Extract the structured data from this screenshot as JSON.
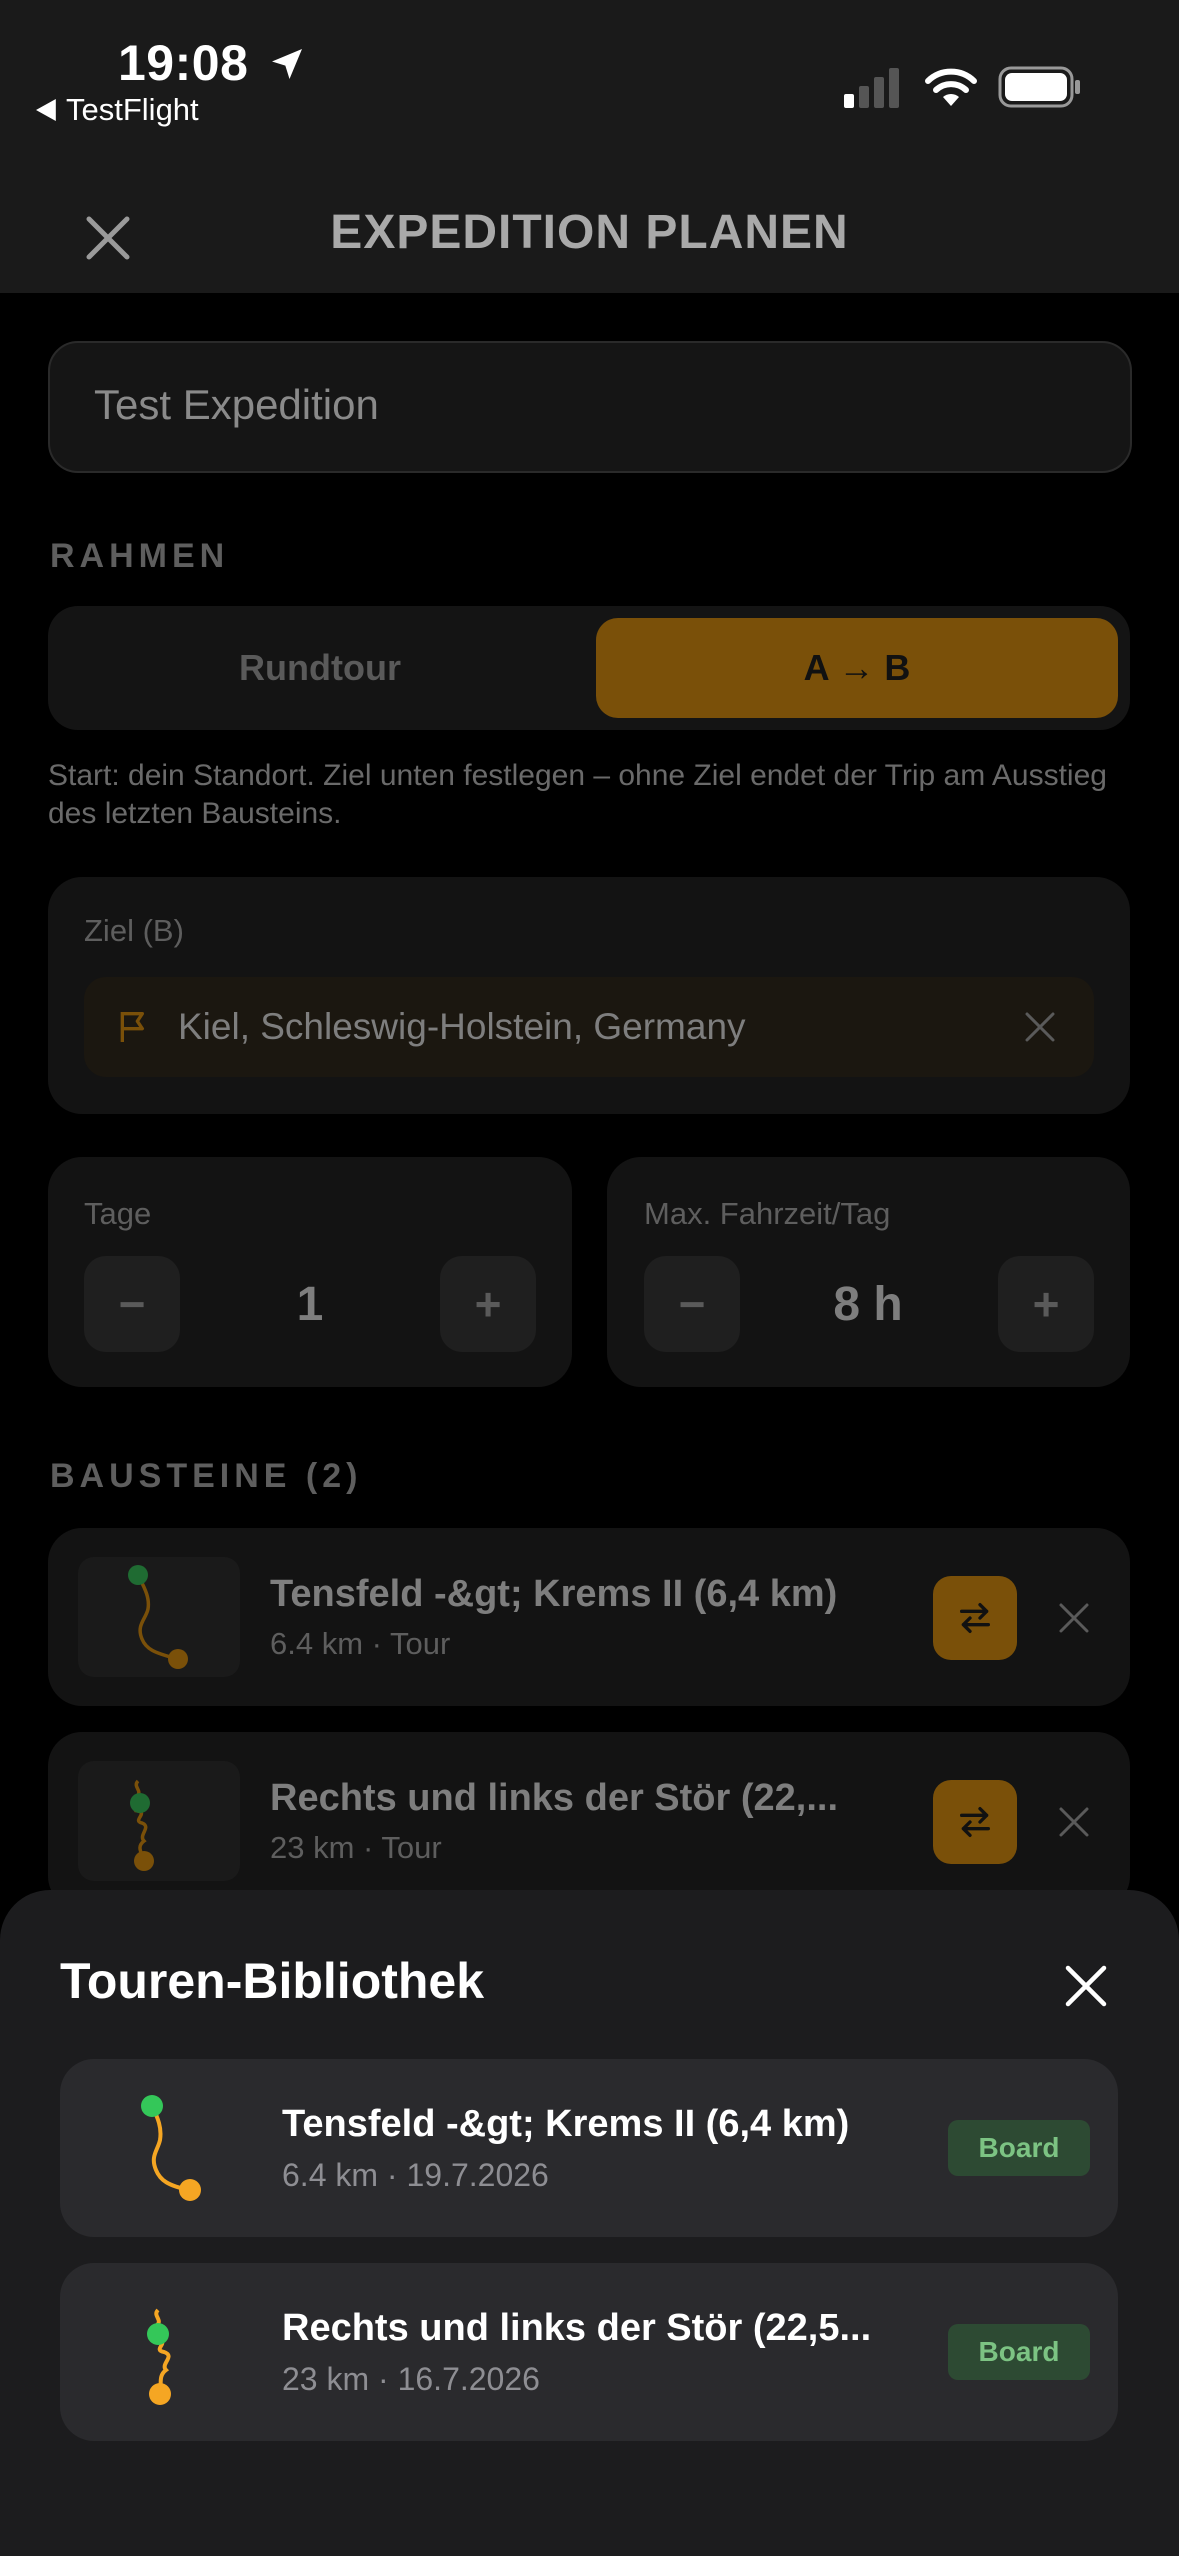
{
  "status_bar": {
    "time": "19:08",
    "back_app": "TestFlight"
  },
  "header": {
    "title": "EXPEDITION PLANEN"
  },
  "expedition_name": {
    "value": "Test Expedition"
  },
  "frame": {
    "section_label": "RAHMEN",
    "options": [
      "Rundtour",
      "A → B"
    ],
    "selected": "A → B",
    "hint": "Start: dein Standort. Ziel unten festlegen – ohne Ziel endet der Trip am Ausstieg des letzten Bausteins."
  },
  "destination": {
    "label": "Ziel (B)",
    "value": "Kiel, Schleswig-Holstein, Germany"
  },
  "days": {
    "label": "Tage",
    "value": "1",
    "minus": "−",
    "plus": "+"
  },
  "max_drive": {
    "label": "Max. Fahrzeit/Tag",
    "value": "8 h",
    "minus": "−",
    "plus": "+"
  },
  "blocks": {
    "section_label": "BAUSTEINE (2)",
    "items": [
      {
        "title": "Tensfeld -&gt; Krems II (6,4 km)",
        "meta": "6.4 km · Tour"
      },
      {
        "title": "Rechts und links der Stör (22,...",
        "meta": "23 km · Tour"
      }
    ]
  },
  "library": {
    "title": "Touren-Bibliothek",
    "items": [
      {
        "title": "Tensfeld -&gt; Krems II (6,4 km)",
        "meta": "6.4 km · 19.7.2026",
        "badge": "Board"
      },
      {
        "title": "Rechts und links der Stör (22,5...",
        "meta": "23 km · 16.7.2026",
        "badge": "Board"
      }
    ]
  },
  "colors": {
    "accent": "#f5a623",
    "accent_dim": "#7a5009",
    "start_dot": "#34c759",
    "badge_bg": "#2d4a33",
    "badge_fg": "#7cc383"
  }
}
